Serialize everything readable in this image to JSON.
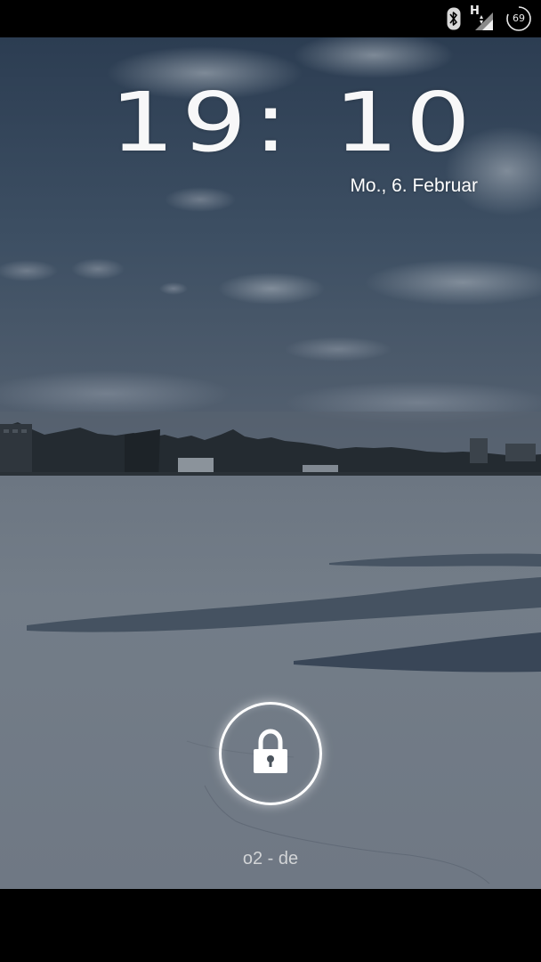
{
  "status_bar": {
    "bluetooth_icon": "bluetooth-icon",
    "network_type": "H",
    "signal_icon": "signal-icon",
    "battery_level": "69"
  },
  "lockscreen": {
    "time": "19: 10",
    "date": "Mo., 6. Februar",
    "unlock_icon": "lock-icon",
    "carrier": "o2 - de"
  },
  "colors": {
    "status_bar_bg": "#000000",
    "text": "#ffffff",
    "carrier_text": "#d2d4d6"
  }
}
